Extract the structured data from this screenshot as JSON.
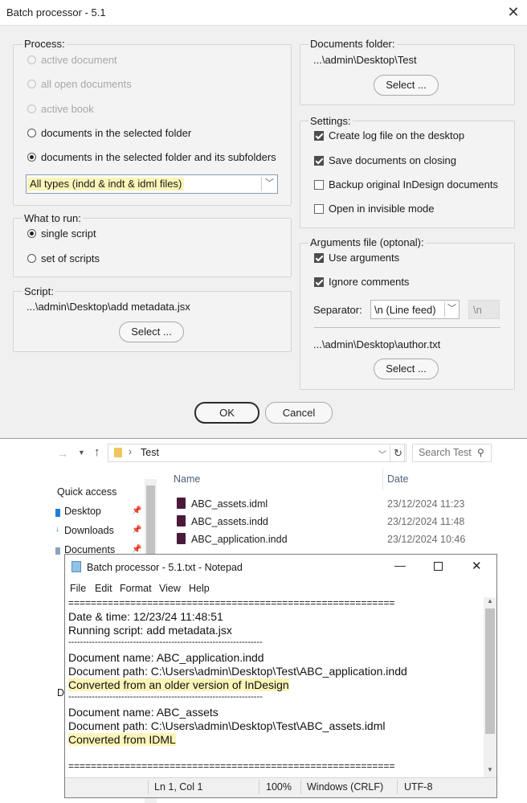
{
  "dialog": {
    "title": "Batch processor - 5.1",
    "process": {
      "title": "Process:",
      "options": [
        "active document",
        "all open documents",
        "active book",
        "documents in the selected folder",
        "documents in the selected folder and its subfolders"
      ],
      "file_types": "All types (indd & indt & idml files)"
    },
    "what_to_run": {
      "title": "What to run:",
      "options": [
        "single script",
        "set of scripts"
      ]
    },
    "script": {
      "title": "Script:",
      "path": "...\\admin\\Desktop\\add metadata.jsx",
      "select_label": "Select ..."
    },
    "documents_folder": {
      "title": "Documents folder:",
      "path": "...\\admin\\Desktop\\Test",
      "select_label": "Select ..."
    },
    "settings": {
      "title": "Settings:",
      "options": [
        "Create log file on the desktop",
        "Save documents on closing",
        "Backup original InDesign documents",
        "Open in invisible mode"
      ]
    },
    "arguments": {
      "title": "Arguments file (optonal):",
      "use_arguments": "Use arguments",
      "ignore_comments": "Ignore comments",
      "separator_label": "Separator:",
      "separator_value": "\\n (Line feed)",
      "separator_preview": "\\n",
      "path": "...\\admin\\Desktop\\author.txt",
      "select_label": "Select ..."
    },
    "ok_label": "OK",
    "cancel_label": "Cancel"
  },
  "explorer": {
    "breadcrumb": "Test",
    "search_placeholder": "Search Test",
    "quick_access": "Quick access",
    "nav_items": [
      "Desktop",
      "Downloads",
      "Documents"
    ],
    "col_name": "Name",
    "col_date": "Date",
    "files": [
      {
        "name": "ABC_assets.idml",
        "date": "23/12/2024 11:23"
      },
      {
        "name": "ABC_assets.indd",
        "date": "23/12/2024 11:48"
      },
      {
        "name": "ABC_application.indd",
        "date": "23/12/2024 10:46"
      }
    ],
    "partial_nav_letter": "D"
  },
  "notepad": {
    "title": "Batch processor - 5.1.txt - Notepad",
    "menu": [
      "File",
      "Edit",
      "Format",
      "View",
      "Help"
    ],
    "lines": [
      "==========================================================",
      "Date & time: 12/23/24 11:48:51",
      "Running script: add metadata.jsx",
      "------------------------------------------------------------------",
      "Document name: ABC_application.indd",
      "Document path: C:\\Users\\admin\\Desktop\\Test\\ABC_application.indd",
      "Converted from an older version of InDesign",
      "------------------------------------------------------------------",
      "Document name: ABC_assets",
      "Document path: C:\\Users\\admin\\Desktop\\Test\\ABC_assets.idml",
      "Converted from IDML",
      "",
      "=========================================================="
    ],
    "status": {
      "position": "Ln 1, Col 1",
      "zoom": "100%",
      "eol": "Windows (CRLF)",
      "encoding": "UTF-8"
    }
  }
}
